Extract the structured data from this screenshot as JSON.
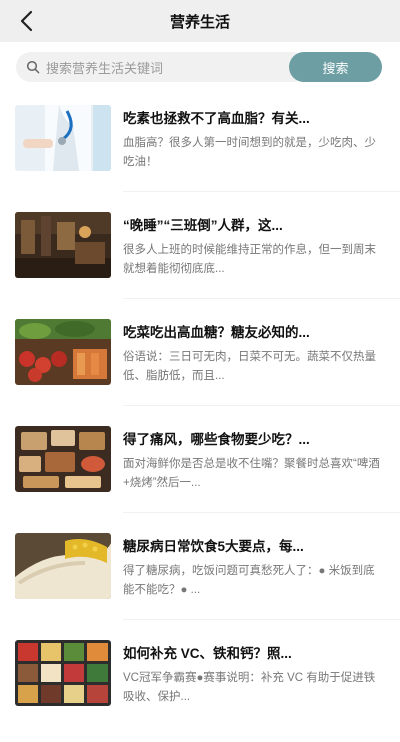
{
  "header": {
    "title": "营养生活",
    "back_icon": "chevron-left-icon"
  },
  "search": {
    "placeholder": "搜索营养生活关键词",
    "button_label": "搜索",
    "button_color": "#6c9ea3"
  },
  "articles": [
    {
      "title": "吃素也拯救不了高血脂？有关...",
      "summary": "血脂高？很多人第一时间想到的就是，少吃肉、少吃油！"
    },
    {
      "title": "“晚睡”“三班倒”人群，这...",
      "summary": "很多人上班的时候能维持正常的作息，但一到周末就想着能彻彻底底..."
    },
    {
      "title": "吃菜吃出高血糖？糖友必知的...",
      "summary": "俗语说：三日可无肉，日菜不可无。蔬菜不仅热量低、脂肪低，而且..."
    },
    {
      "title": "得了痛风，哪些食物要少吃？...",
      "summary": "面对海鲜你是否总是收不住嘴？聚餐时总喜欢“啤酒+烧烤”然后一..."
    },
    {
      "title": "糖尿病日常饮食5大要点，每...",
      "summary": "得了糖尿病，吃饭问题可真愁死人了：● 米饭到底能不能吃？● ..."
    },
    {
      "title": "如何补充 VC、铁和钙？照...",
      "summary": "VC冠军争霸赛●赛事说明：补充 VC 有助于促进铁吸收、保护..."
    }
  ]
}
